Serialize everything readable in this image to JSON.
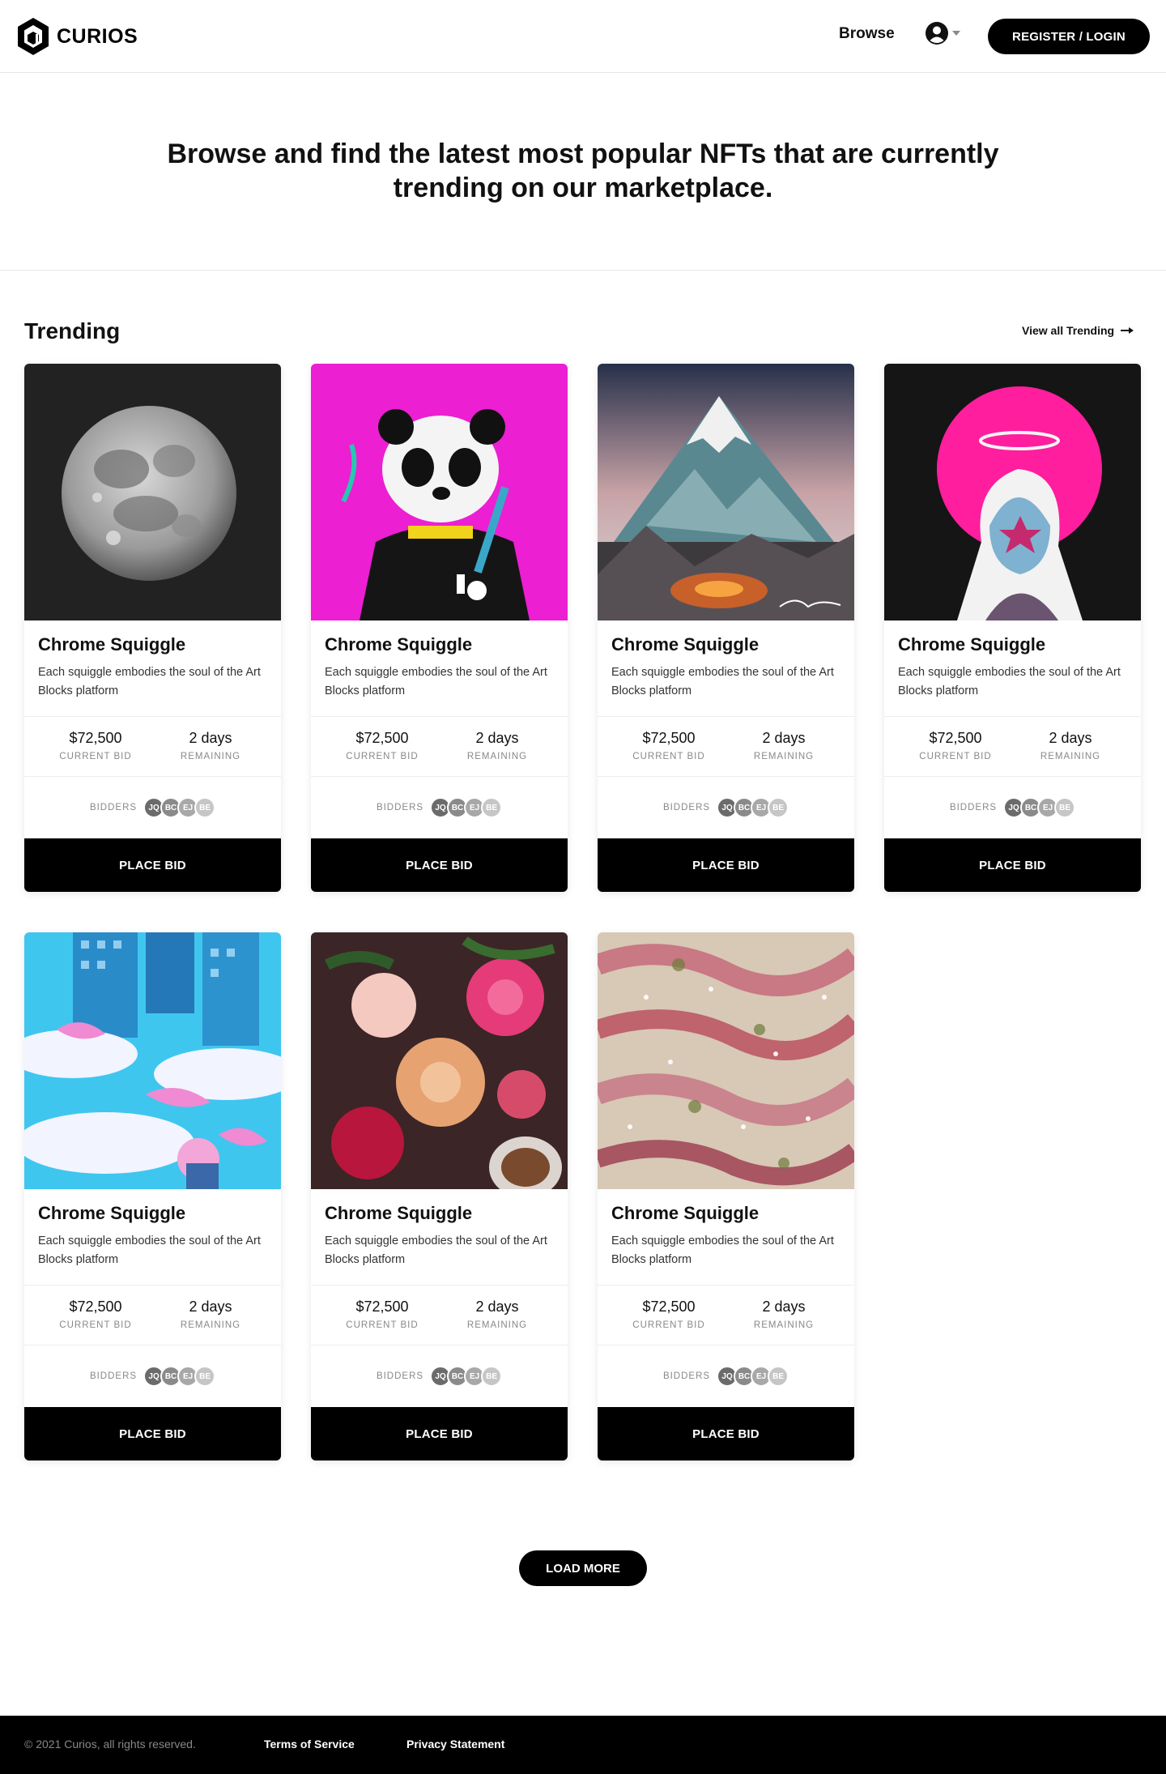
{
  "brand": {
    "name": "CURIOS"
  },
  "nav": {
    "browse": "Browse",
    "login": "REGISTER / LOGIN"
  },
  "hero": {
    "heading": "Browse and find the latest most popular NFTs that are currently trending on our marketplace."
  },
  "trending": {
    "title": "Trending",
    "view_all": "View all Trending"
  },
  "cards": [
    {
      "title": "Chrome Squiggle",
      "description": "Each squiggle embodies the soul of the Art Blocks platform",
      "price": "$72,500",
      "price_label": "CURRENT BID",
      "time": "2 days",
      "time_label": "REMAINING",
      "bidders_label": "BIDDERS",
      "bidders": [
        "JQ",
        "BC",
        "EJ",
        "BE"
      ],
      "button": "PLACE BID",
      "image": "moon"
    },
    {
      "title": "Chrome Squiggle",
      "description": "Each squiggle embodies the soul of the Art Blocks platform",
      "price": "$72,500",
      "price_label": "CURRENT BID",
      "time": "2 days",
      "time_label": "REMAINING",
      "bidders_label": "BIDDERS",
      "bidders": [
        "JQ",
        "BC",
        "EJ",
        "BE"
      ],
      "button": "PLACE BID",
      "image": "panda"
    },
    {
      "title": "Chrome Squiggle",
      "description": "Each squiggle embodies the soul of the Art Blocks platform",
      "price": "$72,500",
      "price_label": "CURRENT BID",
      "time": "2 days",
      "time_label": "REMAINING",
      "bidders_label": "BIDDERS",
      "bidders": [
        "JQ",
        "BC",
        "EJ",
        "BE"
      ],
      "button": "PLACE BID",
      "image": "mountain"
    },
    {
      "title": "Chrome Squiggle",
      "description": "Each squiggle embodies the soul of the Art Blocks platform",
      "price": "$72,500",
      "price_label": "CURRENT BID",
      "time": "2 days",
      "time_label": "REMAINING",
      "bidders_label": "BIDDERS",
      "bidders": [
        "JQ",
        "BC",
        "EJ",
        "BE"
      ],
      "button": "PLACE BID",
      "image": "demon"
    },
    {
      "title": "Chrome Squiggle",
      "description": "Each squiggle embodies the soul of the Art Blocks platform",
      "price": "$72,500",
      "price_label": "CURRENT BID",
      "time": "2 days",
      "time_label": "REMAINING",
      "bidders_label": "BIDDERS",
      "bidders": [
        "JQ",
        "BC",
        "EJ",
        "BE"
      ],
      "button": "PLACE BID",
      "image": "city"
    },
    {
      "title": "Chrome Squiggle",
      "description": "Each squiggle embodies the soul of the Art Blocks platform",
      "price": "$72,500",
      "price_label": "CURRENT BID",
      "time": "2 days",
      "time_label": "REMAINING",
      "bidders_label": "BIDDERS",
      "bidders": [
        "JQ",
        "BC",
        "EJ",
        "BE"
      ],
      "button": "PLACE BID",
      "image": "flowers"
    },
    {
      "title": "Chrome Squiggle",
      "description": "Each squiggle embodies the soul of the Art Blocks platform",
      "price": "$72,500",
      "price_label": "CURRENT BID",
      "time": "2 days",
      "time_label": "REMAINING",
      "bidders_label": "BIDDERS",
      "bidders": [
        "JQ",
        "BC",
        "EJ",
        "BE"
      ],
      "button": "PLACE BID",
      "image": "petals"
    }
  ],
  "load_more": "LOAD MORE",
  "footer": {
    "copyright": "© 2021 Curios, all rights reserved.",
    "terms": "Terms of Service",
    "privacy": "Privacy Statement"
  },
  "colors": {
    "primary": "#000000",
    "bidder_avatars": [
      "#6b6b6b",
      "#8a8a8a",
      "#a8a8a8",
      "#c6c6c6"
    ]
  }
}
